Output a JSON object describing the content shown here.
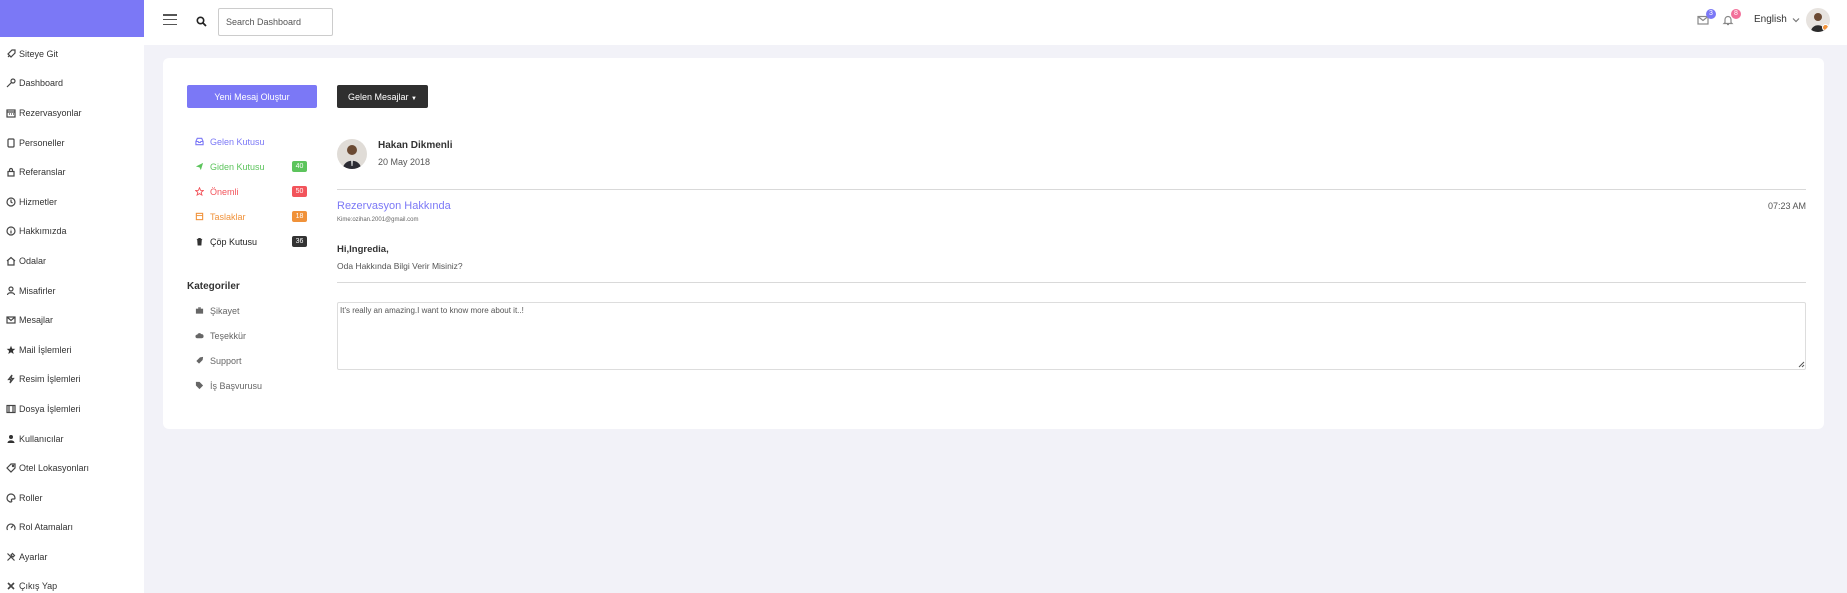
{
  "sidebar": {
    "items": [
      {
        "label": "Siteye Git",
        "icon": "rocket-icon"
      },
      {
        "label": "Dashboard",
        "icon": "key-icon"
      },
      {
        "label": "Rezervasyonlar",
        "icon": "calendar-icon"
      },
      {
        "label": "Personeller",
        "icon": "tablet-icon"
      },
      {
        "label": "Referanslar",
        "icon": "lock-icon"
      },
      {
        "label": "Hizmetler",
        "icon": "clock-icon"
      },
      {
        "label": "Hakkımızda",
        "icon": "info-icon"
      },
      {
        "label": "Odalar",
        "icon": "home-icon"
      },
      {
        "label": "Misafirler",
        "icon": "users-icon"
      },
      {
        "label": "Mesajlar",
        "icon": "mail-icon"
      },
      {
        "label": "Mail İşlemleri",
        "icon": "star-icon"
      },
      {
        "label": "Resim İşlemleri",
        "icon": "bolt-icon"
      },
      {
        "label": "Dosya İşlemleri",
        "icon": "columns-icon"
      },
      {
        "label": "Kullanıcılar",
        "icon": "user-icon"
      },
      {
        "label": "Otel Lokasyonları",
        "icon": "tag-icon"
      },
      {
        "label": "Roller",
        "icon": "palette-icon"
      },
      {
        "label": "Rol Atamaları",
        "icon": "gauge-icon"
      },
      {
        "label": "Ayarlar",
        "icon": "tools-icon"
      },
      {
        "label": "Çıkış Yap",
        "icon": "close-icon"
      }
    ]
  },
  "topbar": {
    "search_placeholder": "Search Dashboard",
    "mail_badge": "3",
    "notif_badge": "8",
    "language": "English"
  },
  "buttons": {
    "new_message": "Yeni Mesaj Oluştur",
    "inbox_dropdown": "Gelen Mesajlar"
  },
  "folders": [
    {
      "label": "Gelen Kutusu",
      "count": "",
      "color": "#7b78f6"
    },
    {
      "label": "Giden Kutusu",
      "count": "40",
      "color": "#5cc45c"
    },
    {
      "label": "Önemli",
      "count": "50",
      "color": "#f2545b"
    },
    {
      "label": "Taslaklar",
      "count": "18",
      "color": "#f0923a"
    },
    {
      "label": "Çöp Kutusu",
      "count": "36",
      "color": "#333333"
    }
  ],
  "categories": {
    "title": "Kategoriler",
    "items": [
      {
        "label": "Şikayet",
        "icon": "briefcase-icon"
      },
      {
        "label": "Teşekkür",
        "icon": "cloud-icon"
      },
      {
        "label": "Support",
        "icon": "rocket-icon"
      },
      {
        "label": "İş Başvurusu",
        "icon": "tags-icon"
      }
    ]
  },
  "message": {
    "sender": "Hakan Dikmenli",
    "date": "20 May 2018",
    "subject": "Rezervasyon Hakkında",
    "email": "Kime:ozihan.2001@gmail.com",
    "time": "07:23 AM",
    "greeting": "Hi,Ingredia,",
    "body": "Oda Hakkında Bilgi Verir Misiniz?",
    "reply": "It's really an amazing.I want to know more about it..!"
  }
}
